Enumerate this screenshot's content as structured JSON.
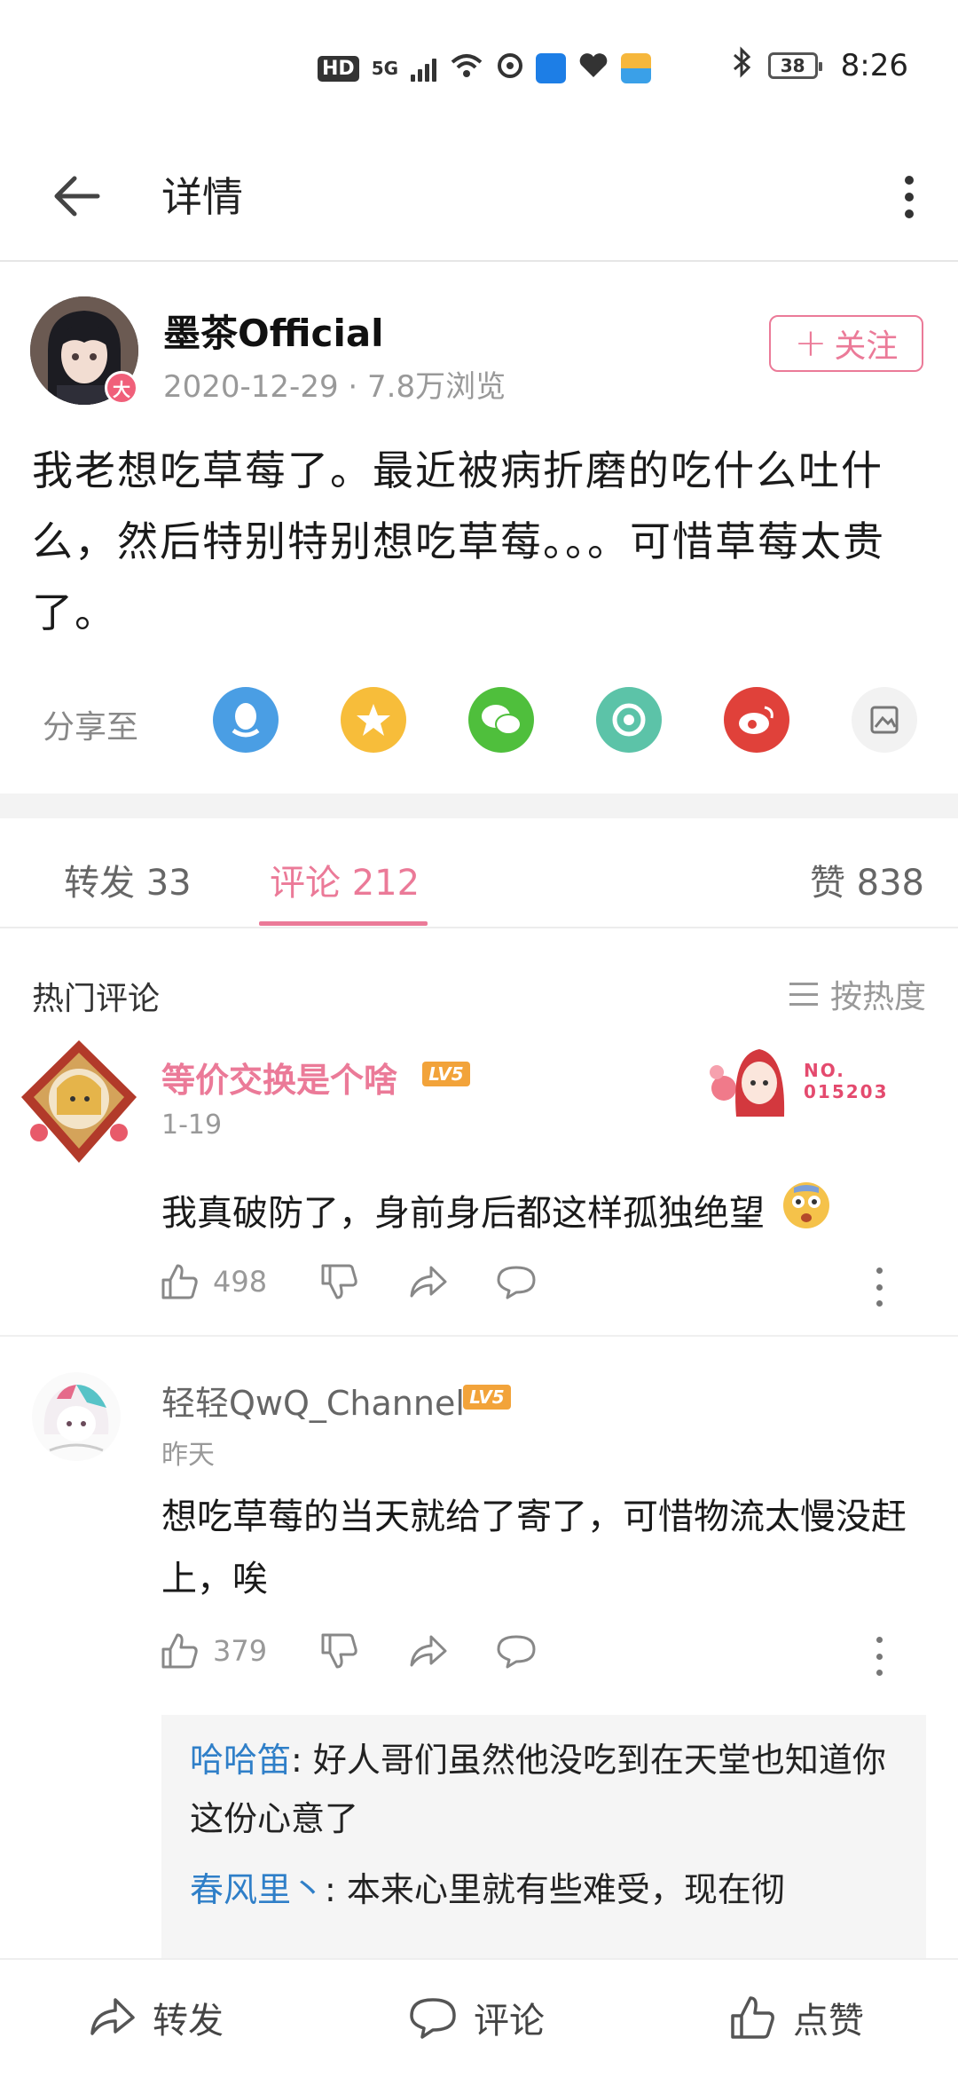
{
  "status_bar": {
    "network": "HD",
    "signal_gen": "5G",
    "battery": "38",
    "time": "8:26"
  },
  "header": {
    "title": "详情"
  },
  "post": {
    "author": "墨茶Official",
    "badge": "大",
    "meta": "2020-12-29 · 7.8万浏览",
    "follow_label": "关注",
    "body": "我老想吃草莓了。最近被病折磨的吃什么吐什么，然后特别特别想吃草莓。。。可惜草莓太贵了。",
    "share_label": "分享至",
    "share_targets": [
      "qq-icon",
      "qzone-icon",
      "wechat-icon",
      "moments-icon",
      "weibo-icon",
      "image-share-icon"
    ]
  },
  "tabs": [
    {
      "label": "转发 33",
      "active": false
    },
    {
      "label": "评论 212",
      "active": true
    },
    {
      "label": "赞 838",
      "active": false
    }
  ],
  "comments_section": {
    "title": "热门评论",
    "sort_label": "按热度"
  },
  "comments": [
    {
      "name": "等价交换是个啥",
      "level": "LV5",
      "date": "1-19",
      "badge_number": "NO.\n015203",
      "text": "我真破防了，身前身后都这样孤独绝望",
      "likes": "498"
    },
    {
      "name": "轻轻QwQ_Channel",
      "level": "LV5",
      "date": "昨天",
      "text": "想吃草莓的当天就给了寄了，可惜物流太慢没赶上，唉",
      "likes": "379",
      "replies": [
        {
          "user": "哈哈笛",
          "text": ": 好人哥们虽然他没吃到在天堂也知道你这份心意了"
        },
        {
          "user": "春风里丶",
          "text": ": 本来心里就有些难受，现在彻"
        }
      ]
    }
  ],
  "bottom_bar": {
    "repost_label": "转发",
    "comment_label": "评论",
    "like_label": "点赞"
  },
  "colors": {
    "accent": "#eb7a98",
    "reply_user": "#2f7fc8",
    "level_badge": "#f2a33a",
    "muted": "#999999"
  }
}
